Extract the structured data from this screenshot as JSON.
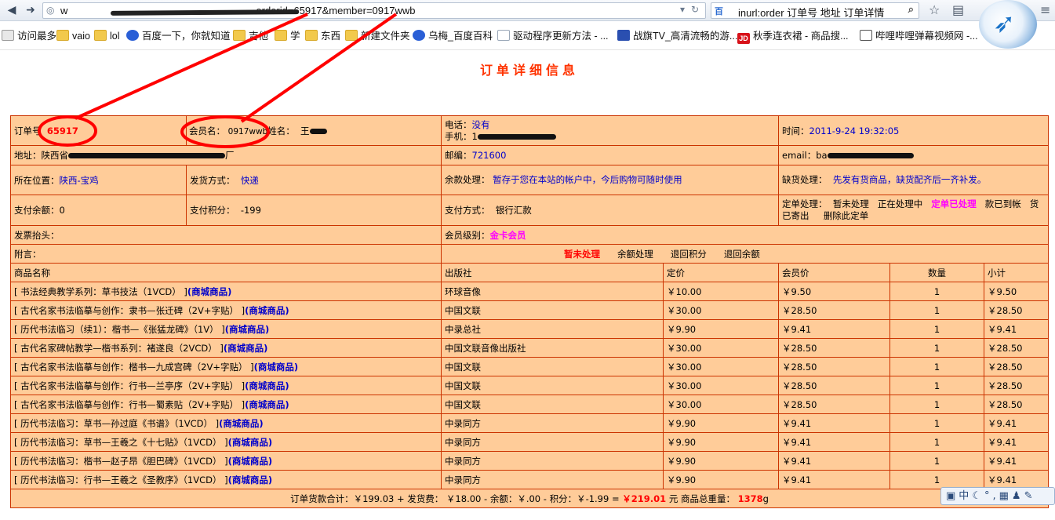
{
  "browser": {
    "url_visible": "w",
    "url_tail": "orderid=65917&member=0917wwb",
    "search_engine": "百",
    "search_query": "inurl:order 订单号 地址 订单详情"
  },
  "bookmarks": [
    {
      "label": "访问最多",
      "icon": "gear-icon"
    },
    {
      "label": "vaio",
      "icon": "folder-icon"
    },
    {
      "label": "lol",
      "icon": "folder-icon"
    },
    {
      "label": "百度一下，你就知道",
      "icon": "paw-icon"
    },
    {
      "label": "吉他",
      "icon": "folder-icon"
    },
    {
      "label": "学",
      "icon": "folder-icon"
    },
    {
      "label": "东西",
      "icon": "folder-icon"
    },
    {
      "label": "新建文件夹",
      "icon": "folder-icon"
    },
    {
      "label": "乌梅_百度百科",
      "icon": "paw-icon"
    },
    {
      "label": "驱动程序更新方法 - ...",
      "icon": "doc-icon"
    },
    {
      "label": "战旗TV_高清流畅的游...",
      "icon": "star-icon"
    },
    {
      "label": "秋季连衣裙 - 商品搜...",
      "icon": "jd-icon"
    },
    {
      "label": "哔哩哔哩弹幕视频网 -...",
      "icon": "tv-icon"
    }
  ],
  "page": {
    "title": "订单详细信息",
    "order_no_label": "订单号",
    "order_no": "65917",
    "member_label": "会员名：",
    "member": "0917wwb",
    "name_label": "姓名：",
    "name_visible": "王",
    "phone_label": "电话：",
    "phone": "没有",
    "mobile_label": "手机：",
    "mobile_visible": "1",
    "time_label": "时间：",
    "time": "2011-9-24 19:32:05",
    "address_label": "地址：",
    "address_visible": "陕西省",
    "address_tail": "厂",
    "postcode_label": "邮编：",
    "postcode": "721600",
    "email_label": "email：",
    "email_visible": "ba",
    "location_label": "所在位置：",
    "location": "陕西-宝鸡",
    "shipping_label": "发货方式：",
    "shipping": "快递",
    "balance_handling_label": "余款处理：",
    "balance_handling": "暂存于您在本站的帐户中，今后购物可随时使用",
    "shortage_label": "缺货处理：",
    "shortage": "先发有货商品，缺货配齐后一齐补发。",
    "paid_balance_label": "支付余额：",
    "paid_balance": "0",
    "paid_points_label": "支付积分：",
    "paid_points": "-199",
    "payment_label": "支付方式：",
    "payment": "银行汇款",
    "order_process_label": "定单处理：",
    "order_status_1": "暂未处理",
    "order_status_2": "正在处理中",
    "order_status_3": "定单已处理",
    "order_status_4": "款已到帐",
    "order_status_5": "货已寄出",
    "order_status_6": "删除此定单",
    "invoice_label": "发票抬头：",
    "member_level_label": "会员级别：",
    "member_level": "金卡会员",
    "note_label": "附言：",
    "action_1": "暂未处理",
    "action_2": "余额处理",
    "action_3": "退回积分",
    "action_4": "退回余额"
  },
  "items_table": {
    "headers": [
      "商品名称",
      "出版社",
      "定价",
      "会员价",
      "数量",
      "小计"
    ],
    "rows": [
      {
        "name": "[ 书法经典教学系列：草书技法（1VCD） ]",
        "tag": "(商城商品)",
        "publisher": "环球音像",
        "price": "￥10.00",
        "member_price": "￥9.50",
        "qty": "1",
        "subtotal": "￥9.50"
      },
      {
        "name": "[ 古代名家书法临摹与创作：隶书—张迁碑（2V+字贴） ]",
        "tag": "(商城商品)",
        "publisher": "中国文联",
        "price": "￥30.00",
        "member_price": "￥28.50",
        "qty": "1",
        "subtotal": "￥28.50"
      },
      {
        "name": "[ 历代书法临习（续1）：楷书—《张猛龙碑》（1V） ]",
        "tag": "(商城商品)",
        "publisher": "中录总社",
        "price": "￥9.90",
        "member_price": "￥9.41",
        "qty": "1",
        "subtotal": "￥9.41"
      },
      {
        "name": "[ 古代名家碑帖教学—楷书系列：褚遂良（2VCD） ]",
        "tag": "(商城商品)",
        "publisher": "中国文联音像出版社",
        "price": "￥30.00",
        "member_price": "￥28.50",
        "qty": "1",
        "subtotal": "￥28.50"
      },
      {
        "name": "[ 古代名家书法临摹与创作：楷书—九成宫碑（2V+字贴） ]",
        "tag": "(商城商品)",
        "publisher": "中国文联",
        "price": "￥30.00",
        "member_price": "￥28.50",
        "qty": "1",
        "subtotal": "￥28.50"
      },
      {
        "name": "[ 古代名家书法临摹与创作：行书—兰亭序（2V+字贴） ]",
        "tag": "(商城商品)",
        "publisher": "中国文联",
        "price": "￥30.00",
        "member_price": "￥28.50",
        "qty": "1",
        "subtotal": "￥28.50"
      },
      {
        "name": "[ 古代名家书法临摹与创作：行书—蜀素贴（2V+字贴） ]",
        "tag": "(商城商品)",
        "publisher": "中国文联",
        "price": "￥30.00",
        "member_price": "￥28.50",
        "qty": "1",
        "subtotal": "￥28.50"
      },
      {
        "name": "[ 历代书法临习：草书—孙过庭《书谱》（1VCD） ]",
        "tag": "(商城商品)",
        "publisher": "中录同方",
        "price": "￥9.90",
        "member_price": "￥9.41",
        "qty": "1",
        "subtotal": "￥9.41"
      },
      {
        "name": "[ 历代书法临习：草书—王羲之《十七贴》（1VCD） ]",
        "tag": "(商城商品)",
        "publisher": "中录同方",
        "price": "￥9.90",
        "member_price": "￥9.41",
        "qty": "1",
        "subtotal": "￥9.41"
      },
      {
        "name": "[ 历代书法临习：楷书—赵子昂《胆巴碑》（1VCD） ]",
        "tag": "(商城商品)",
        "publisher": "中录同方",
        "price": "￥9.90",
        "member_price": "￥9.41",
        "qty": "1",
        "subtotal": "￥9.41"
      },
      {
        "name": "[ 历代书法临习：行书—王羲之《圣教序》（1VCD） ]",
        "tag": "(商城商品)",
        "publisher": "中录同方",
        "price": "￥9.90",
        "member_price": "￥9.41",
        "qty": "1",
        "subtotal": "￥9.41"
      }
    ]
  },
  "summary": {
    "text_1": "订单货款合计：￥199.03 + 发货费： ￥18.00 - 余额：￥.00 - 积分：￥-1.99 =",
    "total": "￥219.01",
    "text_2": "元 商品总重量：",
    "weight": "1378",
    "unit": "g"
  },
  "ime": {
    "label": "中"
  },
  "colors": {
    "table_bg": "#ffcc99",
    "table_border": "#cc3300",
    "title": "#ff3300",
    "link_blue": "#0000cc",
    "annotation_red": "#ff0000"
  }
}
